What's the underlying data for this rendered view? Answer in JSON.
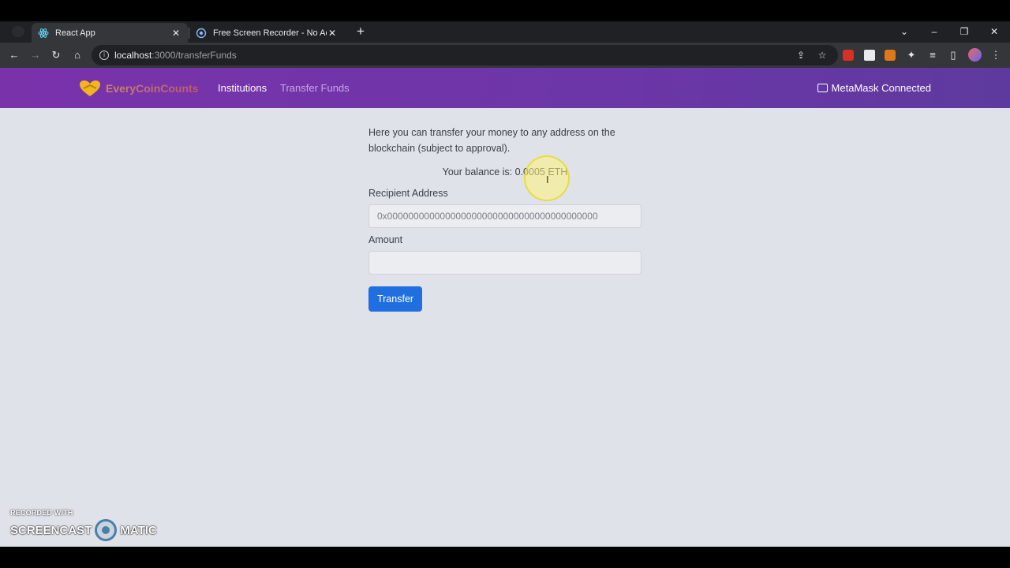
{
  "browser": {
    "tabs": [
      {
        "title": "React App",
        "active": true
      },
      {
        "title": "Free Screen Recorder - No Account",
        "active": false
      }
    ],
    "url_host": "localhost",
    "url_path": ":3000/transferFunds",
    "icons": {
      "back": "arrow-left-icon",
      "forward": "arrow-right-icon",
      "reload": "reload-icon",
      "home": "home-icon",
      "share": "share-icon",
      "bookmark": "star-icon",
      "extensions": "puzzle-icon",
      "menu": "kebab-menu-icon"
    }
  },
  "navbar": {
    "brand": "EveryCoinCounts",
    "links": [
      "Institutions",
      "Transfer Funds"
    ],
    "wallet_status": "MetaMask Connected",
    "colors": {
      "from": "#7a32ab",
      "to": "#5e3a9e"
    }
  },
  "transfer": {
    "intro": "Here you can transfer your money to any address on the blockchain (subject to approval).",
    "balance_label": "Your balance is: 0.0005 ETH",
    "recipient_label": "Recipient Address",
    "recipient_placeholder": "0x0000000000000000000000000000000000000000",
    "amount_label": "Amount",
    "amount_value": "",
    "button_label": "Transfer",
    "button_color": "#1f6fe0"
  },
  "watermark": {
    "top": "RECORDED WITH",
    "left": "SCREENCAST",
    "right": "MATIC"
  }
}
